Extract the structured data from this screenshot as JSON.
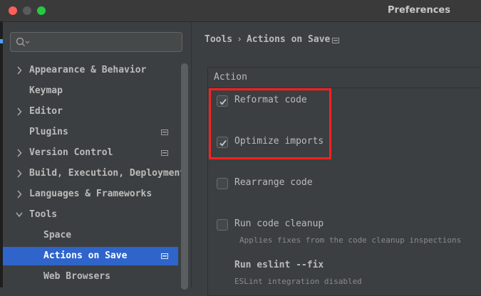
{
  "window": {
    "title": "Preferences"
  },
  "search": {
    "placeholder": ""
  },
  "sidebar": {
    "items": [
      {
        "label": "Appearance & Behavior",
        "has_arrow": true,
        "expanded": false,
        "has_page_icon": false,
        "selected": false,
        "indent": 0
      },
      {
        "label": "Keymap",
        "has_arrow": false,
        "expanded": false,
        "has_page_icon": false,
        "selected": false,
        "indent": 0
      },
      {
        "label": "Editor",
        "has_arrow": true,
        "expanded": false,
        "has_page_icon": false,
        "selected": false,
        "indent": 0
      },
      {
        "label": "Plugins",
        "has_arrow": false,
        "expanded": false,
        "has_page_icon": true,
        "selected": false,
        "indent": 0
      },
      {
        "label": "Version Control",
        "has_arrow": true,
        "expanded": false,
        "has_page_icon": true,
        "selected": false,
        "indent": 0
      },
      {
        "label": "Build, Execution, Deployment",
        "has_arrow": true,
        "expanded": false,
        "has_page_icon": false,
        "selected": false,
        "indent": 0
      },
      {
        "label": "Languages & Frameworks",
        "has_arrow": true,
        "expanded": false,
        "has_page_icon": false,
        "selected": false,
        "indent": 0
      },
      {
        "label": "Tools",
        "has_arrow": true,
        "expanded": true,
        "has_page_icon": false,
        "selected": false,
        "indent": 0
      },
      {
        "label": "Space",
        "has_arrow": false,
        "expanded": false,
        "has_page_icon": false,
        "selected": false,
        "indent": 1
      },
      {
        "label": "Actions on Save",
        "has_arrow": false,
        "expanded": false,
        "has_page_icon": true,
        "selected": true,
        "indent": 1
      },
      {
        "label": "Web Browsers",
        "has_arrow": false,
        "expanded": false,
        "has_page_icon": false,
        "selected": false,
        "indent": 1
      }
    ]
  },
  "breadcrumb": {
    "parent": "Tools",
    "separator": "›",
    "current": "Actions on Save"
  },
  "section": {
    "header": "Action",
    "options": [
      {
        "label": "Reformat code",
        "checked": true
      },
      {
        "label": "Optimize imports",
        "checked": true
      },
      {
        "label": "Rearrange code",
        "checked": false
      },
      {
        "label": "Run code cleanup",
        "checked": false,
        "hint": "Applies fixes from the code cleanup inspections"
      }
    ],
    "eslint": {
      "label": "Run eslint --fix",
      "hint": "ESLint integration disabled"
    }
  },
  "colors": {
    "selection": "#2f65ca",
    "highlight_box": "#ff2020",
    "background": "#3c3f41"
  }
}
